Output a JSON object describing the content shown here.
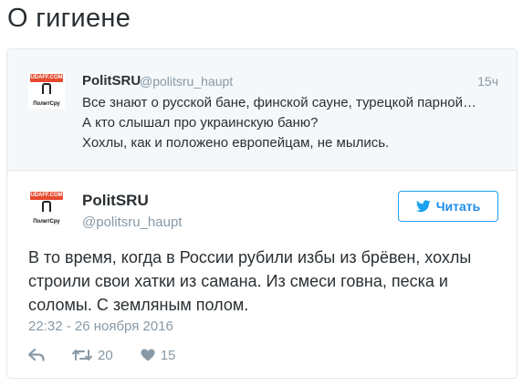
{
  "page": {
    "title": "О гигиене"
  },
  "quoted_tweet": {
    "avatar_badge": "UDAFF.COM",
    "avatar_brand": "ПолитСру",
    "name": "PolitSRU",
    "handle": "@politsru_haupt",
    "time": "15ч",
    "lines": [
      "Все знают о русской бане, финской сауне, турецкой парной…",
      "А кто слышал про украинскую баню?",
      "Хохлы, как и положено европейцам, не мылись."
    ]
  },
  "tweet": {
    "avatar_badge": "UDAFF.COM",
    "avatar_brand": "ПолитСру",
    "name": "PolitSRU",
    "handle": "@politsru_haupt",
    "follow_label": "Читать",
    "lines": [
      "В то время, когда в России рубили избы из брёвен, хохлы",
      "строили свои хатки из самана. Из смеси говна, песка и",
      "соломы. С земляным полом."
    ],
    "date": "22:32 - 26 ноября 2016",
    "retweets": "20",
    "likes": "15"
  },
  "colors": {
    "accent": "#1da1f2",
    "muted": "#8899a6",
    "text": "#292f33",
    "quote_bg": "#f5f8fa"
  },
  "icons": [
    "reply-icon",
    "retweet-icon",
    "heart-icon",
    "twitter-bird-icon"
  ]
}
